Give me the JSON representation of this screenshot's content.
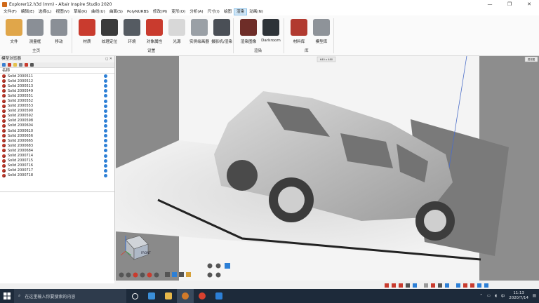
{
  "window": {
    "title": "Explorer12.h3d (mm) - Altair Inspire Studio 2020",
    "minimize": "—",
    "maximize": "❐",
    "close": "✕"
  },
  "menu": [
    "文件(F)",
    "编辑(E)",
    "选择(L)",
    "视图(V)",
    "草绘(K)",
    "曲线(U)",
    "曲面(S)",
    "PolyNURBS",
    "修改(M)",
    "变形(O)",
    "分析(A)",
    "尺寸(I)",
    "绘图",
    "渲染",
    "动画(N)"
  ],
  "menu_active": "渲染",
  "ribbon": {
    "buttons": [
      {
        "label": "文件",
        "icon": "folder-icon",
        "color": "#e0a64a"
      },
      {
        "label": "测量框",
        "icon": "measure-box-icon",
        "color": "#8a8f96"
      },
      {
        "label": "移动",
        "icon": "move-icon",
        "color": "#8a8f96"
      },
      {
        "label": "材质",
        "icon": "material-sphere-icon",
        "color": "#c93b2e"
      },
      {
        "label": "纹理定位",
        "icon": "texture-icon",
        "color": "#3a3a3a"
      },
      {
        "label": "环境",
        "icon": "environment-icon",
        "color": "#555b62"
      },
      {
        "label": "对象属性",
        "icon": "object-properties-icon",
        "color": "#c93b2e"
      },
      {
        "label": "光源",
        "icon": "light-bulb-icon",
        "color": "#d8d8d8"
      },
      {
        "label": "实例绘画器",
        "icon": "instance-painter-icon",
        "color": "#9aa0a6"
      },
      {
        "label": "摄影机/渲染",
        "icon": "camera-icon",
        "color": "#4a4f56"
      },
      {
        "label": "渲染图像",
        "icon": "render-image-icon",
        "color": "#6e2d28"
      },
      {
        "label": "Darkroom",
        "icon": "darkroom-icon",
        "color": "#2e3338"
      },
      {
        "label": "材料库",
        "icon": "material-library-icon",
        "color": "#b13a30"
      },
      {
        "label": "模型库",
        "icon": "model-library-icon",
        "color": "#8e9399"
      }
    ],
    "groups": [
      "主页",
      "设置",
      "渲染",
      "库"
    ]
  },
  "browser": {
    "title": "模型浏览器",
    "title_controls": "◻ ✕",
    "column_name": "名称",
    "items": [
      "Solid 2000511",
      "Solid 2000512",
      "Solid 2000513",
      "Solid 2000549",
      "Solid 2000551",
      "Solid 2000552",
      "Solid 2000553",
      "Solid 2000590",
      "Solid 2000592",
      "Solid 2000598",
      "Solid 2000604",
      "Solid 2000610",
      "Solid 2000656",
      "Solid 2000665",
      "Solid 2000683",
      "Solid 2000684",
      "Solid 2000714",
      "Solid 2000715",
      "Solid 2000716",
      "Solid 2000717",
      "Solid 2000718"
    ]
  },
  "viewport": {
    "render_size": "640 x 480",
    "view_label": "透视图",
    "cube_label": "FRONT"
  },
  "taskbar": {
    "search_placeholder": "在这里输入你要搜索的内容",
    "time": "11:13",
    "date": "2020/7/14",
    "input_method": "中"
  }
}
